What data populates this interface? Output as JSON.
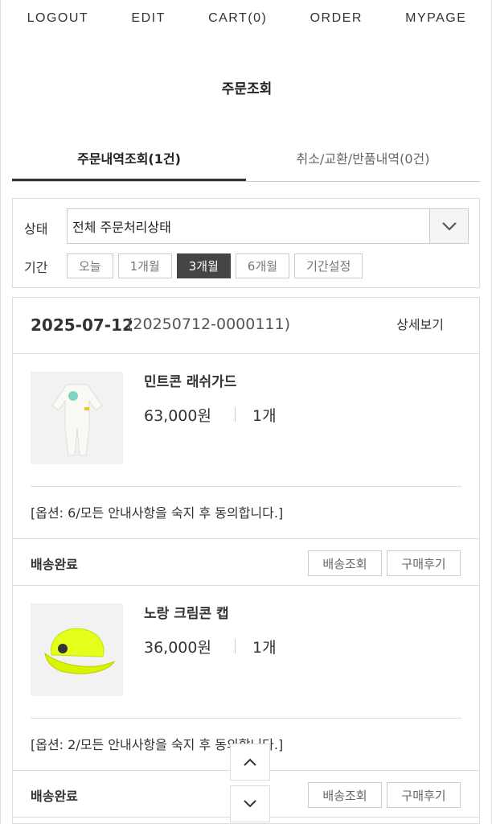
{
  "nav": {
    "logout": "LOGOUT",
    "edit": "EDIT",
    "cart": "CART(0)",
    "order": "ORDER",
    "mypage": "MYPAGE"
  },
  "page_title": "주문조회",
  "tabs": [
    {
      "label": "주문내역조회(1건)"
    },
    {
      "label": "취소/교환/반품내역(0건)"
    }
  ],
  "filter": {
    "status_label": "상태",
    "status_value": "전체 주문처리상태",
    "period_label": "기간",
    "periods": [
      "오늘",
      "1개월",
      "3개월",
      "6개월",
      "기간설정"
    ],
    "active_period": "3개월"
  },
  "order": {
    "date": "2025-07-12",
    "number": "(20250712-0000111)",
    "detail_label": "상세보기",
    "items": [
      {
        "name": "민트콘 래쉬가드",
        "price": "63,000원",
        "qty": "1개",
        "option": "[옵션: 6/모든 안내사항을 숙지 후 동의합니다.]",
        "status": "배송완료",
        "track_label": "배송조회",
        "review_label": "구매후기"
      },
      {
        "name": "노랑 크림콘 캡",
        "price": "36,000원",
        "qty": "1개",
        "option": "[옵션: 2/모든 안내사항을 숙지 후 동의합니다.]",
        "status": "배송완료",
        "track_label": "배송조회",
        "review_label": "구매후기"
      }
    ]
  },
  "icons": {
    "select": "chevron-down-icon",
    "scroll_up": "chevron-up-icon",
    "scroll_down": "chevron-down-icon"
  },
  "colors": {
    "active_period_bg": "#444444",
    "cap_yellow": "#e4ff1a"
  }
}
